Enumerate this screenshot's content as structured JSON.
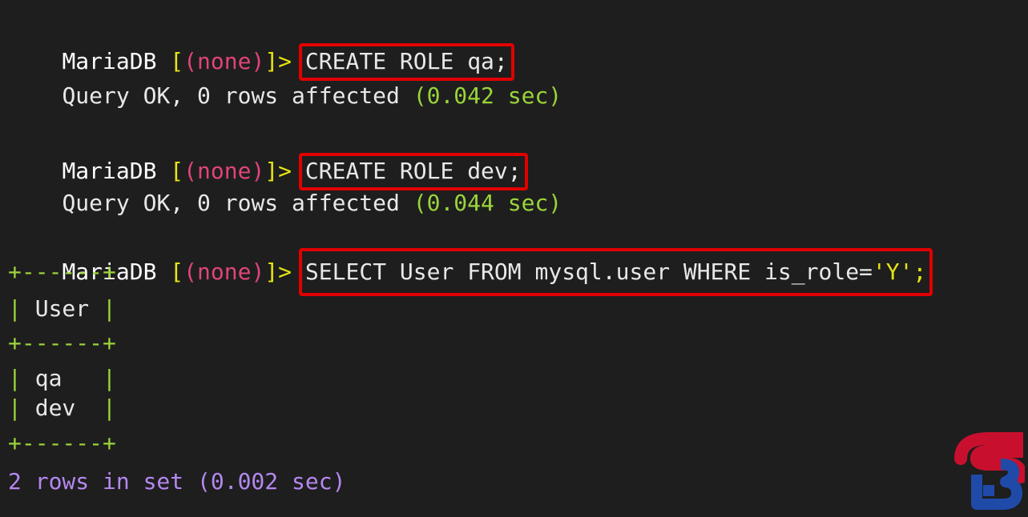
{
  "terminal": {
    "prompt": {
      "db": "MariaDB",
      "open": " [",
      "context": "(none)",
      "close": "]>",
      "space": " "
    },
    "commands": [
      {
        "text": "CREATE ROLE qa;"
      },
      {
        "text": "CREATE ROLE dev;"
      },
      {
        "text": "SELECT User FROM mysql.user WHERE is_role=",
        "string_literal": "'Y'",
        "terminator": ";"
      }
    ],
    "results": [
      {
        "prefix": "Query OK, 0 rows affected ",
        "time": "(0.042 sec)"
      },
      {
        "prefix": "Query OK, 0 rows affected ",
        "time": "(0.044 sec)"
      }
    ],
    "table": {
      "border": "+------+",
      "header_row": "| User |",
      "rows": [
        "| qa   |",
        "| dev  |"
      ]
    },
    "footer": "2 rows in set (0.002 sec)"
  },
  "colors": {
    "background": "#1e1e1e",
    "prompt_bracket": "#e5e510",
    "context": "#e0447a",
    "green": "#9bd43a",
    "purple": "#b488f0",
    "highlight": "#e10000"
  },
  "logo": {
    "icon": "sb-logo-icon",
    "letters": "SB"
  }
}
